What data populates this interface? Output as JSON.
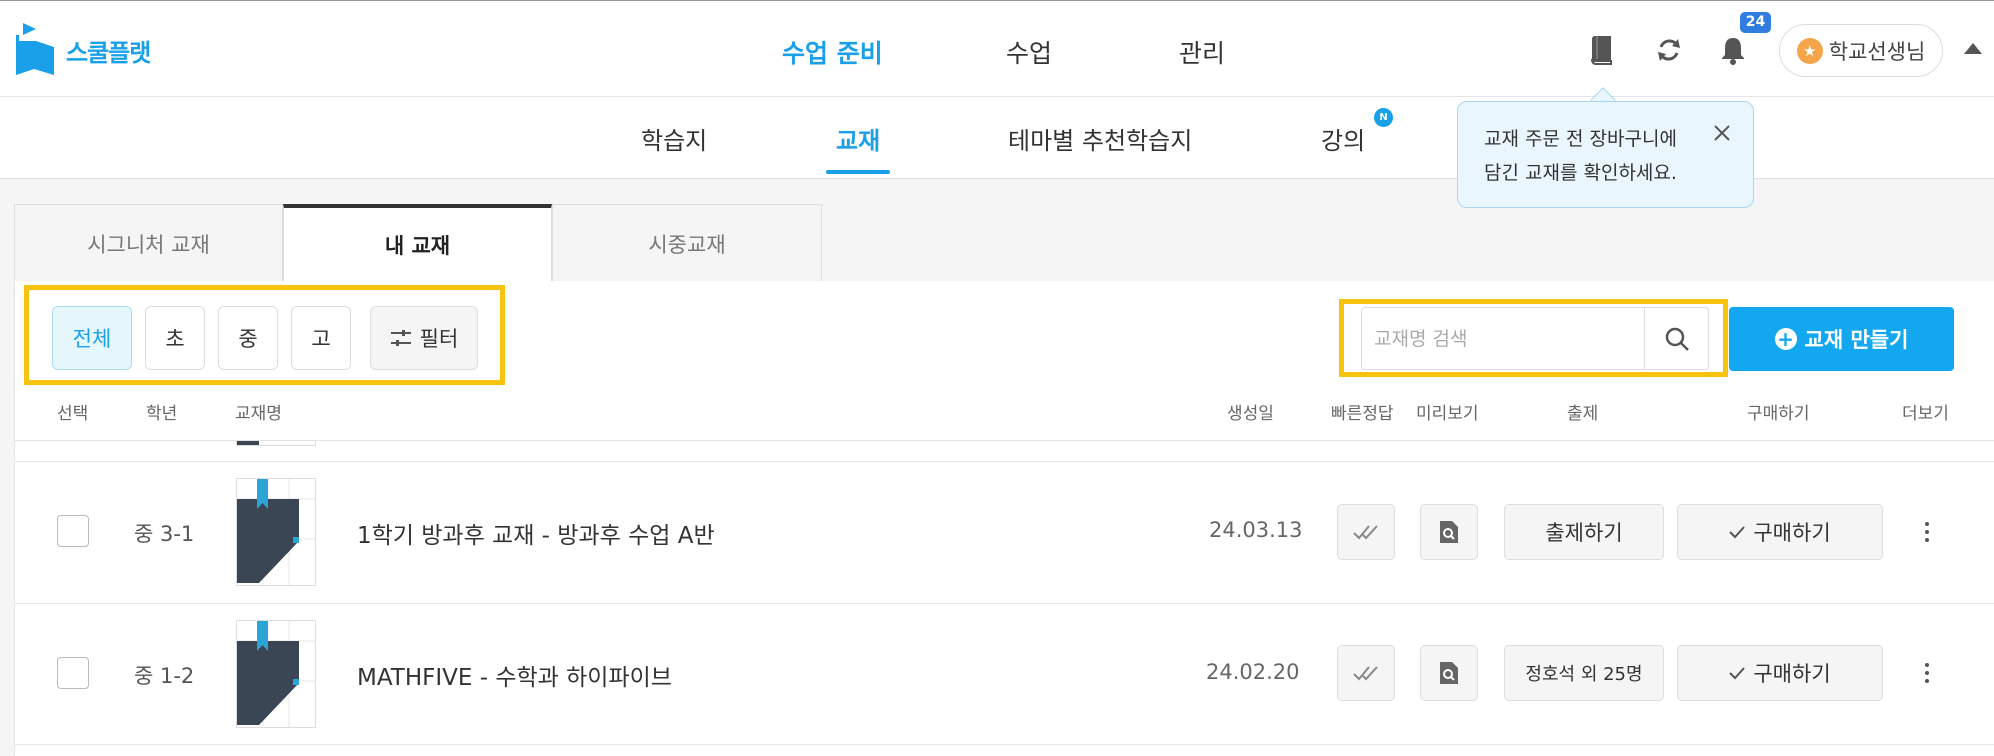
{
  "brand": {
    "name": "스쿨플랫",
    "color": "#1aa0e8"
  },
  "main_nav": [
    {
      "label": "수업 준비",
      "active": true
    },
    {
      "label": "수업",
      "active": false
    },
    {
      "label": "관리",
      "active": false
    }
  ],
  "header_icons": [
    "book-icon",
    "refresh-icon",
    "bell-icon"
  ],
  "notifications": {
    "count": "24"
  },
  "user": {
    "name": "학교선생님",
    "badge_icon": "star-icon"
  },
  "sub_nav": [
    {
      "label": "학습지",
      "active": false
    },
    {
      "label": "교재",
      "active": true
    },
    {
      "label": "테마별 추천학습지",
      "active": false
    },
    {
      "label": "강의",
      "active": false,
      "new_badge": "N"
    }
  ],
  "tooltip": {
    "line1": "교재 주문 전 장바구니에",
    "line2": "담긴 교재를 확인하세요."
  },
  "tabs": [
    {
      "label": "시그니처 교재",
      "active": false
    },
    {
      "label": "내 교재",
      "active": true
    },
    {
      "label": "시중교재",
      "active": false
    }
  ],
  "grade_filters": [
    {
      "label": "전체",
      "active": true
    },
    {
      "label": "초",
      "active": false
    },
    {
      "label": "중",
      "active": false
    },
    {
      "label": "고",
      "active": false
    }
  ],
  "filter_button": {
    "label": "필터",
    "icon": "sliders-icon"
  },
  "search": {
    "placeholder": "교재명 검색",
    "value": ""
  },
  "create_button": {
    "label": "교재 만들기"
  },
  "columns": {
    "select": "선택",
    "grade": "학년",
    "name": "교재명",
    "created": "생성일",
    "quick_answer": "빠른정답",
    "preview": "미리보기",
    "assign": "출제",
    "purchase": "구매하기",
    "more": "더보기"
  },
  "rows": [
    {
      "grade": "중 3-1",
      "title": "1학기 방과후 교재 - 방과후 수업 A반",
      "date": "24.03.13",
      "assign_label": "출제하기",
      "purchase_label": "구매하기",
      "checked": false
    },
    {
      "grade": "중 1-2",
      "title": "MATHFIVE - 수학과 하이파이브",
      "date": "24.02.20",
      "assign_label": "정호석 외 25명",
      "purchase_label": "구매하기",
      "checked": false
    }
  ],
  "colors": {
    "accent": "#1aa0e8",
    "create_button": "#13a7f0",
    "highlight": "#f7c30f",
    "badge": "#2f7de1"
  }
}
